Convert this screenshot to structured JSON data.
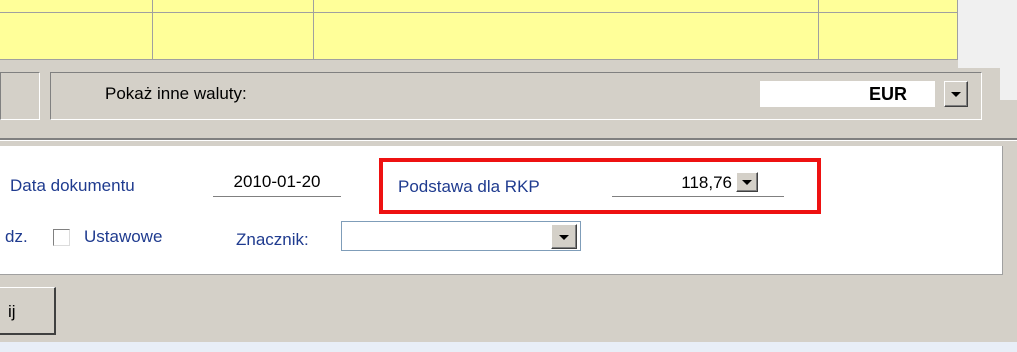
{
  "currency": {
    "label": "Pokaż inne waluty:",
    "selected": "EUR"
  },
  "form": {
    "data_dokumentu_label": "Data dokumentu",
    "data_dokumentu_value": "2010-01-20",
    "podstawa_label": "Podstawa dla RKP",
    "podstawa_value": "118,76",
    "partial_label": "dz.",
    "ustawowe_label": "Ustawowe",
    "ustawowe_checked": false,
    "znacznik_label": "Znacznik:",
    "znacznik_value": ""
  },
  "buttons": {
    "partial_button_label": "ij"
  },
  "colors": {
    "grid_yellow": "#ffff99",
    "highlight_red": "#ee1111",
    "label_blue": "#1f3b8f"
  },
  "icons": {
    "dropdown": "chevron-down-icon"
  }
}
